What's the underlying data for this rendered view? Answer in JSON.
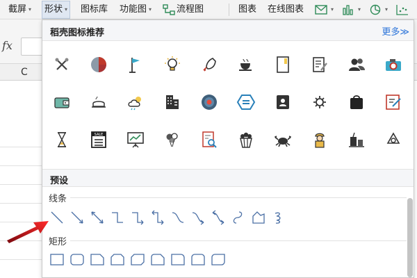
{
  "toolbar": {
    "screenshot": "截屏",
    "shapes": "形状",
    "icon_library": "图标库",
    "function_chart": "功能图",
    "flowchart": "流程图",
    "chart": "图表",
    "online_chart": "在线图表"
  },
  "formula": {
    "fx": "fx",
    "column": "C"
  },
  "panel": {
    "title": "稻壳图标推荐",
    "more": "更多≫",
    "icons_row1": [
      "tools-icon",
      "pie-chart-icon",
      "flag-icon",
      "lightbulb-icon",
      "rocket-icon",
      "coffee-icon",
      "notebook-icon",
      "document-edit-icon",
      "users-icon",
      "camera-icon"
    ],
    "icons_row2": [
      "wallet-icon",
      "bread-icon",
      "cloud-sun-icon",
      "building-icon",
      "target-icon",
      "hexagon-icon",
      "contact-book-icon",
      "gear-icon",
      "shopping-bag-icon",
      "note-edit-icon"
    ],
    "icons_row3": [
      "hourglass-icon",
      "sale-board-icon",
      "presentation-icon",
      "balloons-icon",
      "search-document-icon",
      "popcorn-icon",
      "crab-icon",
      "worker-icon",
      "drink-icon",
      "recycle-icon"
    ]
  },
  "presets": {
    "title": "预设",
    "lines_label": "线条",
    "rect_label": "矩形"
  },
  "colors": {
    "link": "#2a73d9",
    "annotation_arrow": "#e0141e",
    "shape_stroke": "#4a6fa5"
  }
}
